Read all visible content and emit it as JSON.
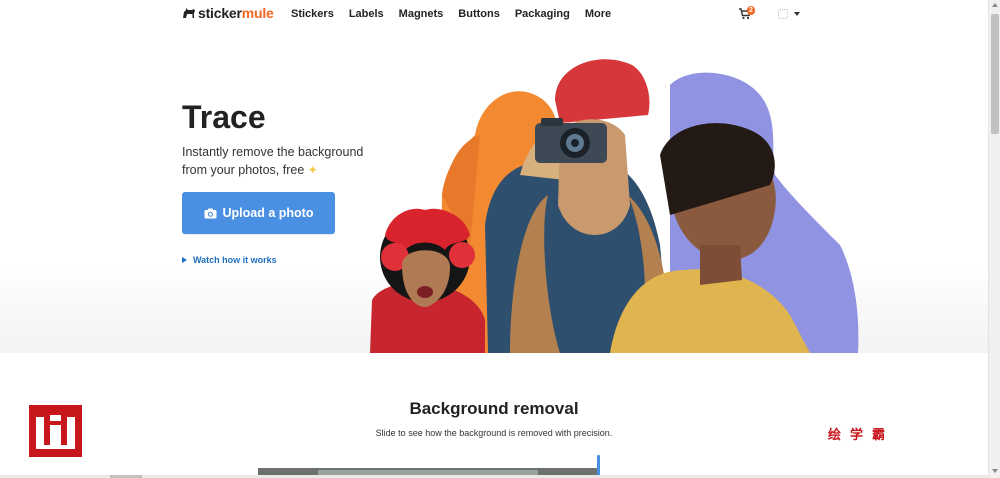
{
  "header": {
    "logo": {
      "brand_part1": "sticker",
      "brand_part2": "mule",
      "icon": "mule-icon"
    },
    "nav": [
      "Stickers",
      "Labels",
      "Magnets",
      "Buttons",
      "Packaging",
      "More"
    ],
    "cart": {
      "icon": "cart-icon",
      "count": "2"
    },
    "account": {
      "icon": "user-icon",
      "caret_icon": "chevron-down-icon"
    }
  },
  "hero": {
    "title": "Trace",
    "subtitle": "Instantly remove the background from your photos, free",
    "sparkle_icon": "sparkle-icon",
    "upload_button": {
      "label": "Upload a photo",
      "icon": "camera-icon"
    },
    "watch_link": {
      "label": "Watch how it works",
      "icon": "play-icon"
    },
    "image": "hero-collage-image"
  },
  "section": {
    "title": "Background removal",
    "subtitle": "Slide to see how the background is removed with precision."
  },
  "watermarks": {
    "left_logo": "w-logo",
    "right_text": "绘学霸"
  },
  "colors": {
    "brand_orange": "#f26722",
    "button_blue": "#4a90e2",
    "link_blue": "#1f6fbf",
    "watermark_red": "#c8161d"
  }
}
